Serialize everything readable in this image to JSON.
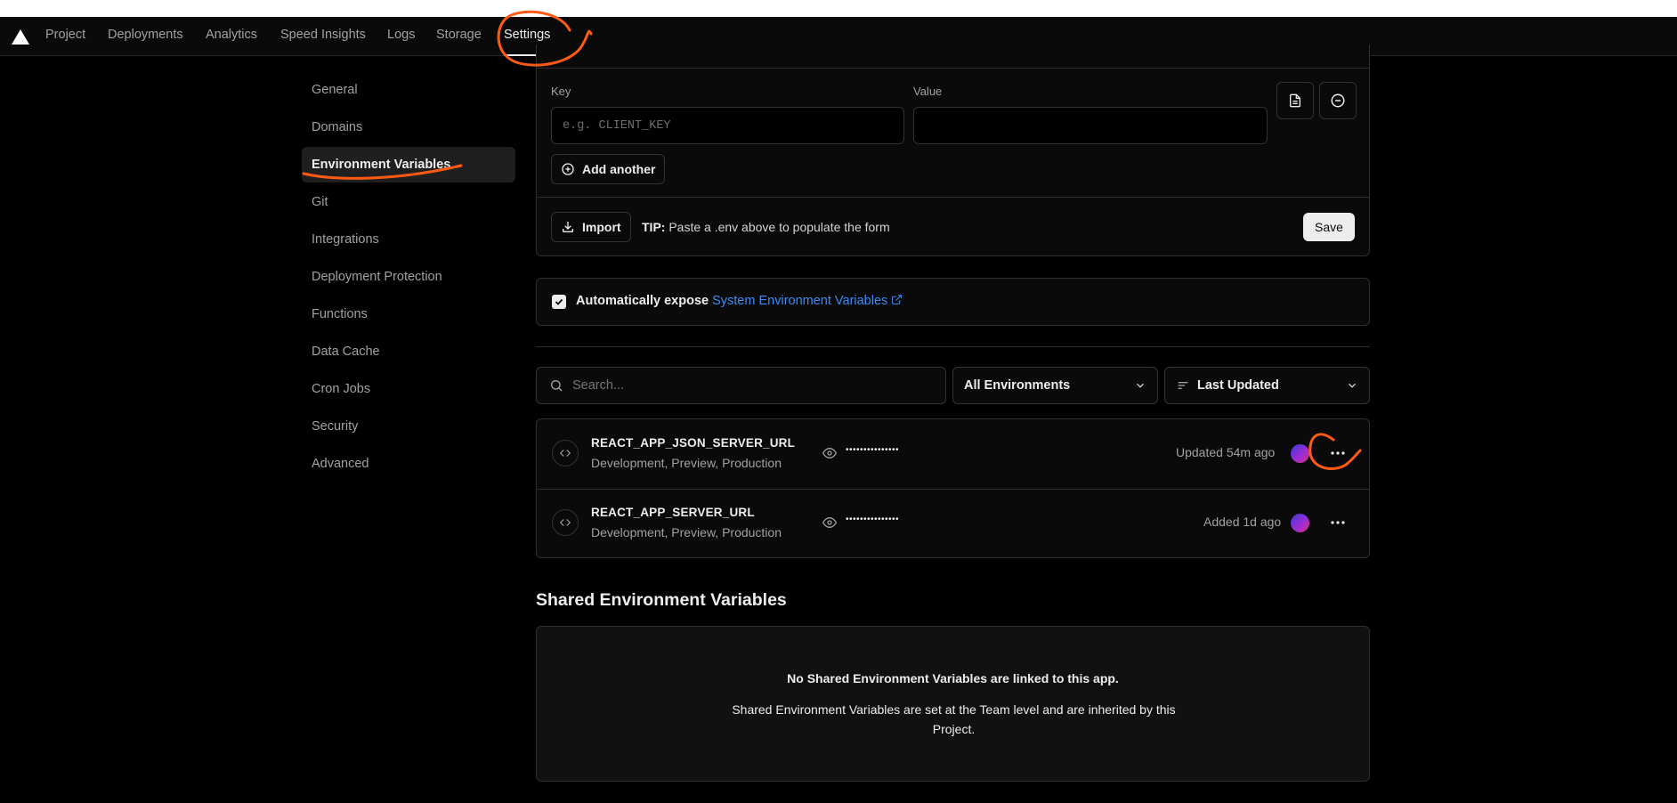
{
  "nav": {
    "tabs": [
      {
        "label": "Project"
      },
      {
        "label": "Deployments"
      },
      {
        "label": "Analytics"
      },
      {
        "label": "Speed Insights"
      },
      {
        "label": "Logs"
      },
      {
        "label": "Storage"
      },
      {
        "label": "Settings",
        "active": true
      }
    ]
  },
  "sidebar": {
    "items": [
      {
        "label": "General"
      },
      {
        "label": "Domains"
      },
      {
        "label": "Environment Variables",
        "active": true
      },
      {
        "label": "Git"
      },
      {
        "label": "Integrations"
      },
      {
        "label": "Deployment Protection"
      },
      {
        "label": "Functions"
      },
      {
        "label": "Data Cache"
      },
      {
        "label": "Cron Jobs"
      },
      {
        "label": "Security"
      },
      {
        "label": "Advanced"
      }
    ]
  },
  "form": {
    "key_label": "Key",
    "value_label": "Value",
    "key_placeholder": "e.g. CLIENT_KEY",
    "value_value": "",
    "add_another": "Add another",
    "import": "Import",
    "tip_bold": "TIP:",
    "tip_text": "Paste a .env above to populate the form",
    "save": "Save"
  },
  "auto_expose": {
    "checked": true,
    "text": "Automatically expose",
    "link": "System Environment Variables"
  },
  "filters": {
    "search_placeholder": "Search...",
    "environment": "All Environments",
    "sort": "Last Updated"
  },
  "variables": [
    {
      "name": "REACT_APP_JSON_SERVER_URL",
      "environments": "Development, Preview, Production",
      "masked": "•••••••••••••••",
      "status": "Updated 54m ago"
    },
    {
      "name": "REACT_APP_SERVER_URL",
      "environments": "Development, Preview, Production",
      "masked": "•••••••••••••••",
      "status": "Added 1d ago"
    }
  ],
  "shared": {
    "title": "Shared Environment Variables",
    "empty_title": "No Shared Environment Variables are linked to this app.",
    "empty_desc": "Shared Environment Variables are set at the Team level and are inherited by this Project."
  },
  "colors": {
    "background": "#000000",
    "accent_link": "#3b8cf6",
    "annotation": "#ff5a14"
  },
  "icons": [
    "vercel-logo-icon",
    "file-text-icon",
    "minus-circle-icon",
    "plus-circle-icon",
    "download-icon",
    "check-icon",
    "external-link-icon",
    "search-icon",
    "chevron-down-icon",
    "sort-lines-icon",
    "code-icon",
    "eye-icon",
    "more-horizontal-icon"
  ]
}
